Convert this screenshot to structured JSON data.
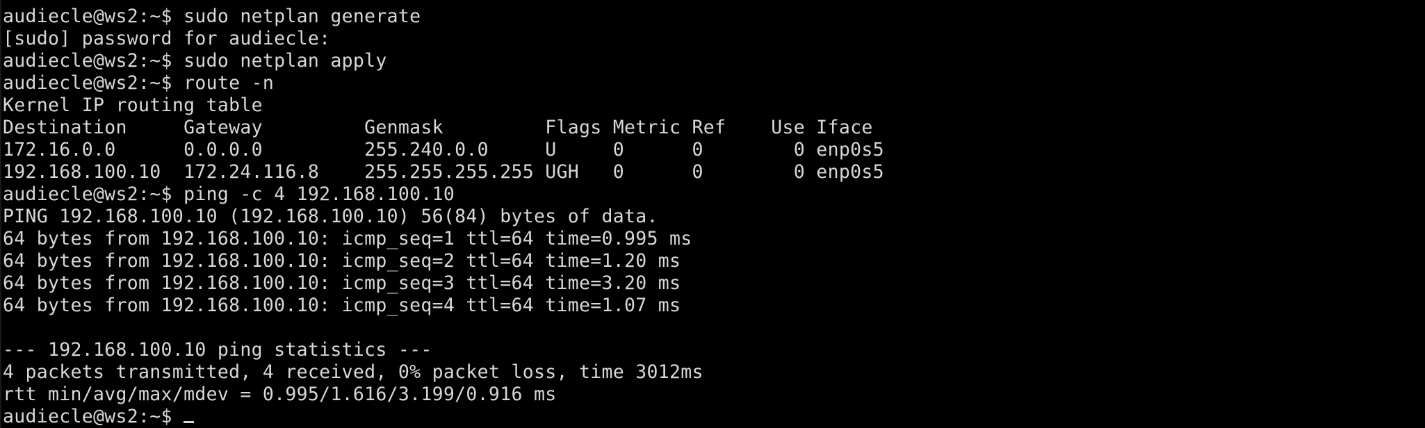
{
  "terminal": {
    "lines": [
      "audiecle@ws2:~$ sudo netplan generate",
      "[sudo] password for audiecle:",
      "audiecle@ws2:~$ sudo netplan apply",
      "audiecle@ws2:~$ route -n",
      "Kernel IP routing table",
      "Destination     Gateway         Genmask         Flags Metric Ref    Use Iface",
      "172.16.0.0      0.0.0.0         255.240.0.0     U     0      0        0 enp0s5",
      "192.168.100.10  172.24.116.8    255.255.255.255 UGH   0      0        0 enp0s5",
      "audiecle@ws2:~$ ping -c 4 192.168.100.10",
      "PING 192.168.100.10 (192.168.100.10) 56(84) bytes of data.",
      "64 bytes from 192.168.100.10: icmp_seq=1 ttl=64 time=0.995 ms",
      "64 bytes from 192.168.100.10: icmp_seq=2 ttl=64 time=1.20 ms",
      "64 bytes from 192.168.100.10: icmp_seq=3 ttl=64 time=3.20 ms",
      "64 bytes from 192.168.100.10: icmp_seq=4 ttl=64 time=1.07 ms",
      "",
      "--- 192.168.100.10 ping statistics ---",
      "4 packets transmitted, 4 received, 0% packet loss, time 3012ms",
      "rtt min/avg/max/mdev = 0.995/1.616/3.199/0.916 ms"
    ],
    "prompt": "audiecle@ws2:~$ ",
    "colors": {
      "background": "#000000",
      "foreground": "#d8d8d8"
    }
  }
}
